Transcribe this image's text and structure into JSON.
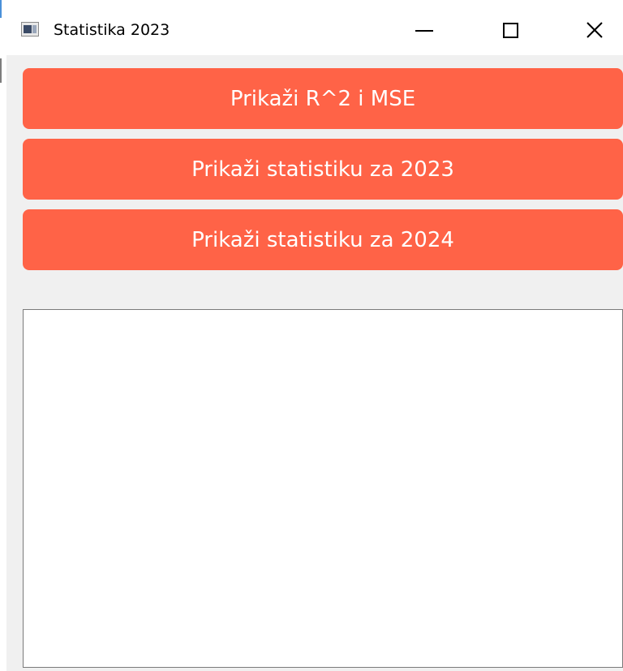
{
  "window": {
    "title": "Statistika 2023",
    "app_icon": "window-app-icon",
    "controls": {
      "minimize_icon": "minimize-icon",
      "maximize_icon": "maximize-icon",
      "close_icon": "close-icon"
    }
  },
  "buttons": {
    "r2_mse": "Prikaži R^2 i MSE",
    "stats_2023": "Prikaži statistiku za 2023",
    "stats_2024": "Prikaži statistiku za 2024"
  },
  "output": {
    "text": ""
  },
  "colors": {
    "button_bg": "#ff6347",
    "button_text": "#ffffff",
    "client_bg": "#f0f0f0"
  }
}
